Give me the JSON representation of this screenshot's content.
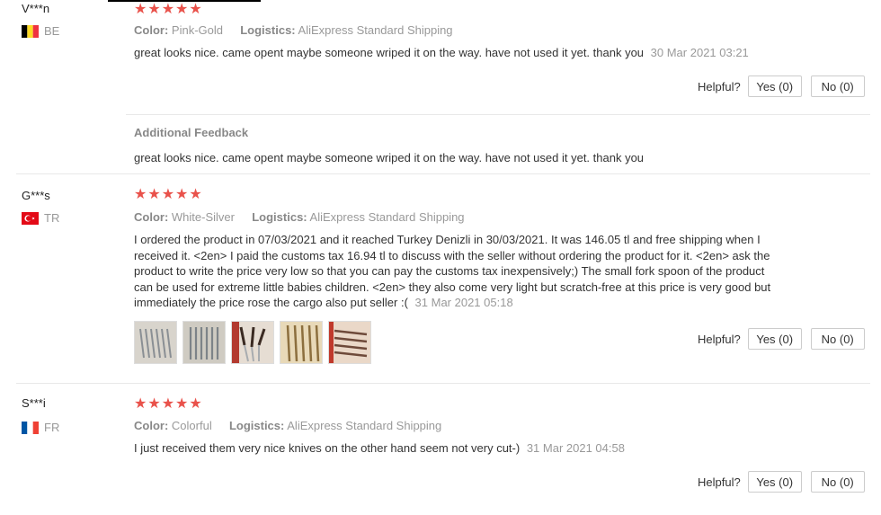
{
  "reviews": [
    {
      "user": "V***n",
      "country": "BE",
      "stars": "★★★★★",
      "color_label": "Color:",
      "color_value": "Pink-Gold",
      "logistics_label": "Logistics:",
      "logistics_value": "AliExpress Standard Shipping",
      "text": "great looks nice. came opent maybe someone wriped it on the way. have not used it yet. thank you",
      "date": "30 Mar 2021 03:21",
      "helpful_label": "Helpful?",
      "yes_label": "Yes (0)",
      "no_label": "No (0)",
      "additional_title": "Additional Feedback",
      "additional_text": "great looks nice. came opent maybe someone wriped it on the way. have not used it yet. thank you"
    },
    {
      "user": "G***s",
      "country": "TR",
      "stars": "★★★★★",
      "color_label": "Color:",
      "color_value": "White-Silver",
      "logistics_label": "Logistics:",
      "logistics_value": "AliExpress Standard Shipping",
      "text": "I ordered the product in 07/03/2021 and it reached Turkey Denizli in 30/03/2021. It was 146.05 tl and free shipping when I received it. <2en> I paid the customs tax 16.94 tl to discuss with the seller without ordering the product for it. <2en> ask the product to write the price very low so that you can pay the customs tax inexpensively;) The small fork spoon of the product can be used for extreme little babies children. <2en> they also come very light but scratch-free at this price is very good but immediately the price rose the cargo also put seller :(",
      "date": "31 Mar 2021 05:18",
      "helpful_label": "Helpful?",
      "yes_label": "Yes (0)",
      "no_label": "No (0)"
    },
    {
      "user": "S***i",
      "country": "FR",
      "stars": "★★★★★",
      "color_label": "Color:",
      "color_value": "Colorful",
      "logistics_label": "Logistics:",
      "logistics_value": "AliExpress Standard Shipping",
      "text": "I just received them very nice knives on the other hand seem not very cut-)",
      "date": "31 Mar 2021 04:58",
      "helpful_label": "Helpful?",
      "yes_label": "Yes (0)",
      "no_label": "No (0)"
    }
  ],
  "colors": {
    "star": "#e9524b",
    "muted": "#999999",
    "text": "#333333"
  }
}
